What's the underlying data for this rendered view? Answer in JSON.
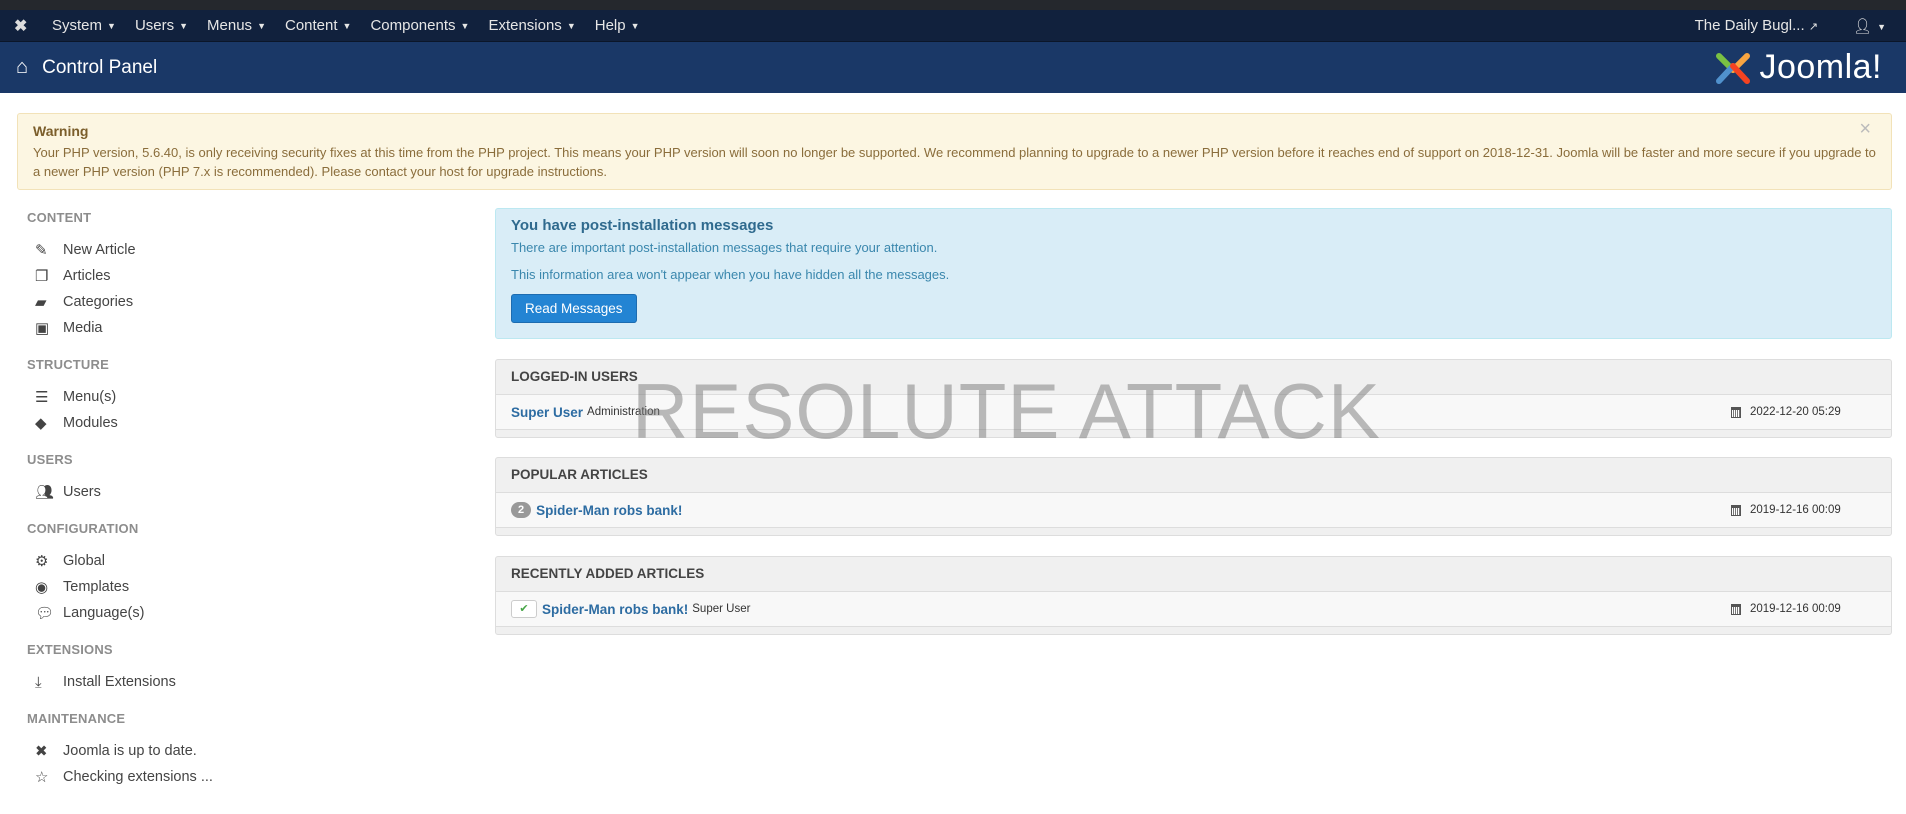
{
  "navbar": {
    "menu": [
      "System",
      "Users",
      "Menus",
      "Content",
      "Components",
      "Extensions",
      "Help"
    ],
    "site_name": "The Daily Bugl..."
  },
  "header": {
    "title": "Control Panel",
    "brand": "Joomla!"
  },
  "warning": {
    "title": "Warning",
    "text": "Your PHP version, 5.6.40, is only receiving security fixes at this time from the PHP project. This means your PHP version will soon no longer be supported. We recommend planning to upgrade to a newer PHP version before it reaches end of support on 2018-12-31. Joomla will be faster and more secure if you upgrade to a newer PHP version (PHP 7.x is recommended). Please contact your host for upgrade instructions.",
    "close": "×"
  },
  "sidebar": {
    "content": {
      "title": "CONTENT",
      "items": [
        "New Article",
        "Articles",
        "Categories",
        "Media"
      ]
    },
    "structure": {
      "title": "STRUCTURE",
      "items": [
        "Menu(s)",
        "Modules"
      ]
    },
    "users": {
      "title": "USERS",
      "items": [
        "Users"
      ]
    },
    "configuration": {
      "title": "CONFIGURATION",
      "items": [
        "Global",
        "Templates",
        "Language(s)"
      ]
    },
    "extensions": {
      "title": "EXTENSIONS",
      "items": [
        "Install Extensions"
      ]
    },
    "maintenance": {
      "title": "MAINTENANCE",
      "items": [
        "Joomla is up to date.",
        "Checking extensions ..."
      ]
    }
  },
  "postinstall": {
    "title": "You have post-installation messages",
    "line1": "There are important post-installation messages that require your attention.",
    "line2": "This information area won't appear when you have hidden all the messages.",
    "button": "Read Messages"
  },
  "logged_in": {
    "title": "LOGGED-IN USERS",
    "rows": [
      {
        "name": "Super User",
        "sub": "Administration",
        "date": "2022-12-20 05:29"
      }
    ]
  },
  "popular": {
    "title": "POPULAR ARTICLES",
    "rows": [
      {
        "hits": "2",
        "title": "Spider-Man robs bank!",
        "date": "2019-12-16 00:09"
      }
    ]
  },
  "recent": {
    "title": "RECENTLY ADDED ARTICLES",
    "rows": [
      {
        "title": "Spider-Man robs bank!",
        "author": "Super User",
        "date": "2019-12-16 00:09"
      }
    ]
  },
  "watermark": "RESOLUTE ATTACK"
}
